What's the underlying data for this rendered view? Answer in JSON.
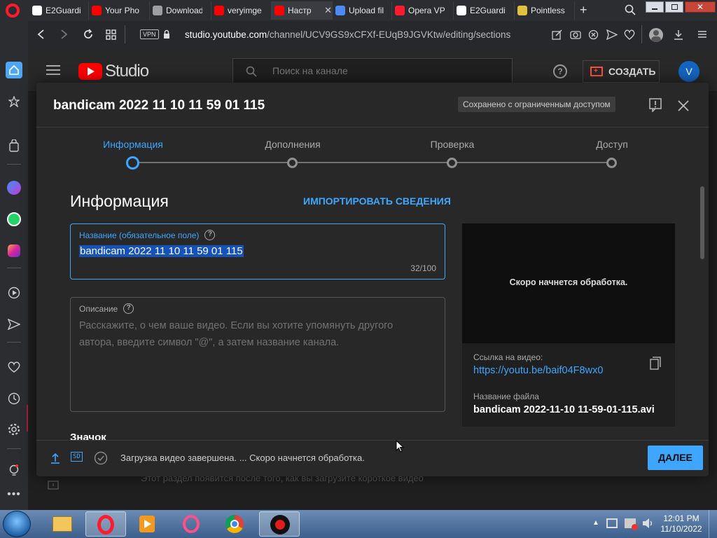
{
  "browser": {
    "tabs": [
      {
        "label": "E2Guardi",
        "favicon": "e2guardian-icon",
        "color": "#ffffff"
      },
      {
        "label": "Your Pho",
        "favicon": "youtube-icon",
        "color": "#ff0000"
      },
      {
        "label": "Download",
        "favicon": "globe-icon",
        "color": "#9aa0a6"
      },
      {
        "label": "veryimge",
        "favicon": "youtube-icon",
        "color": "#ff0000"
      },
      {
        "label": "Настр",
        "favicon": "youtube-icon",
        "color": "#ff0000",
        "active": true
      },
      {
        "label": "Upload fil",
        "favicon": "upload-icon",
        "color": "#4c8bf5"
      },
      {
        "label": "Opera VP",
        "favicon": "opera-icon",
        "color": "#ff1b2d"
      },
      {
        "label": "E2Guardi",
        "favicon": "e2guardian-icon",
        "color": "#ffffff"
      },
      {
        "label": "Pointless",
        "favicon": "pencil-icon",
        "color": "#e0c040"
      }
    ],
    "url_domain": "studio.youtube.com",
    "url_path": "/channel/UCV9GS9xCFXf-EUqB9JGVKtw/editing/sections",
    "vpn_label": "VPN"
  },
  "studio": {
    "logo_text": "Studio",
    "search_placeholder": "Поиск на канале",
    "create_label": "СОЗДАТЬ",
    "avatar_letter": "V",
    "background_hint": "Этот раздел появится после того, как вы загрузите короткое видео"
  },
  "modal": {
    "title": "bandicam 2022 11 10 11 59 01 115",
    "saved_badge": "Сохранено с ограниченным доступом",
    "steps": [
      "Информация",
      "Дополнения",
      "Проверка",
      "Доступ"
    ],
    "section_title": "Информация",
    "import_label": "ИМПОРТИРОВАТЬ СВЕДЕНИЯ",
    "title_field_label": "Название (обязательное поле)",
    "title_field_value": "bandicam 2022 11 10 11 59 01 115",
    "title_counter": "32/100",
    "desc_label": "Описание",
    "desc_placeholder_line1": "Расскажите, о чем ваше видео. Если вы хотите упомянуть другого",
    "desc_placeholder_line2": "автора, введите символ \"@\", а затем название канала.",
    "thumb_heading": "Значок",
    "preview_text": "Скоро начнется обработка.",
    "link_label": "Ссылка на видео:",
    "link_value": "https://youtu.be/baif04F8wx0",
    "filename_label": "Название файла",
    "filename_value": "bandicam 2022-11-10 11-59-01-115.avi",
    "quality_badge": "SD",
    "footer_status": "Загрузка видео завершена. ... Скоро начнется обработка.",
    "next_label": "ДАЛЕЕ"
  },
  "taskbar": {
    "time": "12:01 PM",
    "date": "11/10/2022"
  },
  "colors": {
    "accent": "#3ea6ff",
    "bg": "#282828",
    "youtube_red": "#ff0000",
    "opera_red": "#ff1b2d"
  }
}
